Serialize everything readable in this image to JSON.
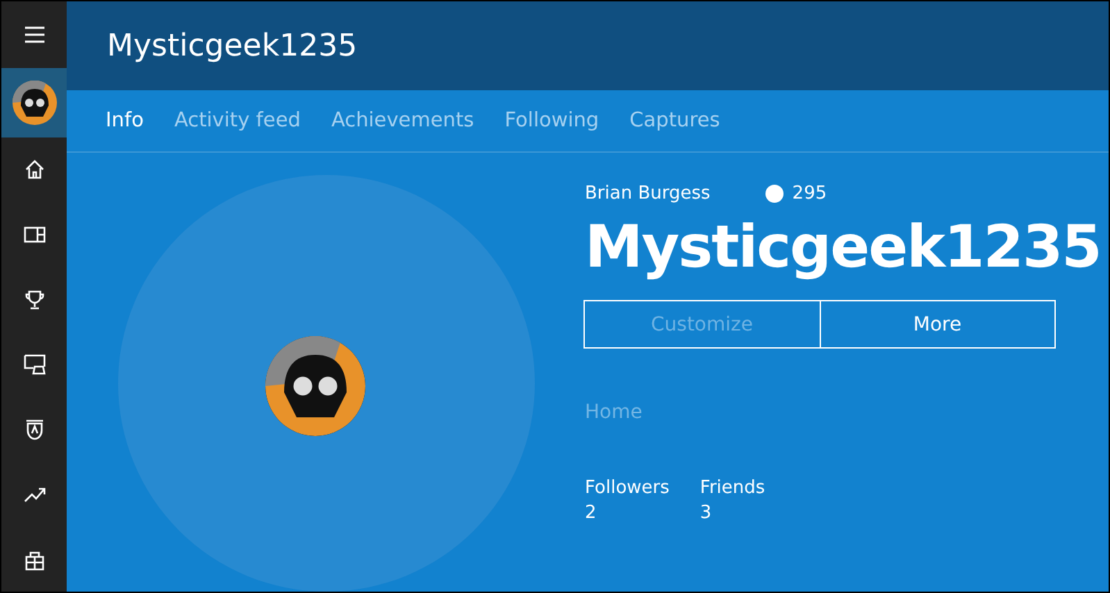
{
  "header": {
    "title": "Mysticgeek1235"
  },
  "tabs": [
    {
      "label": "Info",
      "selected": true
    },
    {
      "label": "Activity feed",
      "selected": false
    },
    {
      "label": "Achievements",
      "selected": false
    },
    {
      "label": "Following",
      "selected": false
    },
    {
      "label": "Captures",
      "selected": false
    }
  ],
  "sidebar": {
    "items": [
      {
        "kind": "home",
        "selected": false
      },
      {
        "kind": "panels",
        "selected": false
      },
      {
        "kind": "trophy",
        "selected": false
      },
      {
        "kind": "game",
        "selected": false
      },
      {
        "kind": "shield",
        "selected": false
      },
      {
        "kind": "trend",
        "selected": false
      },
      {
        "kind": "store",
        "selected": false
      }
    ]
  },
  "profile": {
    "real_name": "Brian Burgess",
    "gamerscore": "295",
    "gamertag": "Mysticgeek1235",
    "buttons": [
      {
        "label": "Customize",
        "disabled": true
      },
      {
        "label": "More",
        "disabled": false
      }
    ],
    "location": "Home",
    "stats": [
      {
        "label": "Followers",
        "value": "2"
      },
      {
        "label": "Friends",
        "value": "3"
      }
    ]
  }
}
